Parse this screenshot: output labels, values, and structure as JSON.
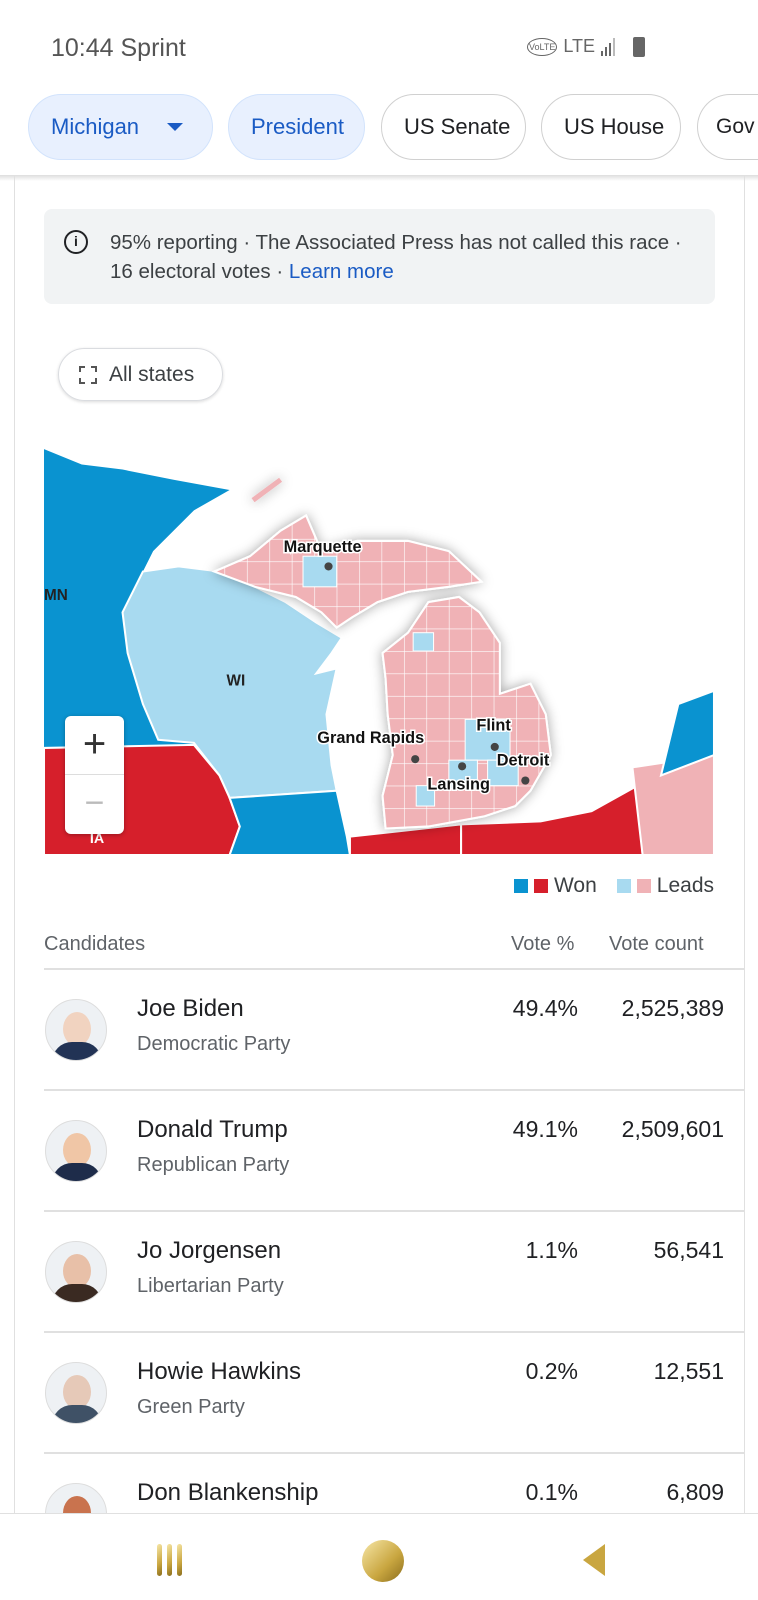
{
  "status_bar": {
    "time_carrier": "10:44 Sprint",
    "icons": [
      "volte-icon",
      "lte-icon",
      "signal-icon",
      "battery-icon"
    ],
    "volte": "VoLTE",
    "lte": "LTE"
  },
  "chips": [
    {
      "label": "Michigan",
      "selected": true,
      "dropdown": true
    },
    {
      "label": "President",
      "selected": true
    },
    {
      "label": "US Senate"
    },
    {
      "label": "US House"
    },
    {
      "label": "Gov"
    }
  ],
  "info": {
    "text": "95% reporting · The Associated Press has not called this race · 16 electoral votes · ",
    "link": "Learn more",
    "icon": "info-icon"
  },
  "all_states": "All states",
  "map": {
    "state_labels": [
      "MN",
      "WI",
      "IA"
    ],
    "city_labels": [
      "Marquette",
      "Grand Rapids",
      "Flint",
      "Detroit",
      "Lansing"
    ],
    "zoom_in": "+",
    "zoom_out": "−",
    "colors": {
      "dem_won": "#0a93d0",
      "rep_won": "#d61f2b",
      "dem_leads": "#a8daf0",
      "rep_leads": "#f0b2b6"
    }
  },
  "legend": {
    "won": "Won",
    "leads": "Leads"
  },
  "table": {
    "headers": {
      "candidates": "Candidates",
      "vote_pct": "Vote %",
      "vote_count": "Vote count"
    },
    "rows": [
      {
        "name": "Joe Biden",
        "party": "Democratic Party",
        "pct": "49.4%",
        "count": "2,525,389"
      },
      {
        "name": "Donald Trump",
        "party": "Republican Party",
        "pct": "49.1%",
        "count": "2,509,601"
      },
      {
        "name": "Jo Jorgensen",
        "party": "Libertarian Party",
        "pct": "1.1%",
        "count": "56,541"
      },
      {
        "name": "Howie Hawkins",
        "party": "Green Party",
        "pct": "0.2%",
        "count": "12,551"
      },
      {
        "name": "Don Blankenship",
        "party": "",
        "pct": "0.1%",
        "count": "6,809"
      }
    ]
  },
  "nav": [
    "recent-apps-icon",
    "home-icon",
    "back-icon"
  ]
}
